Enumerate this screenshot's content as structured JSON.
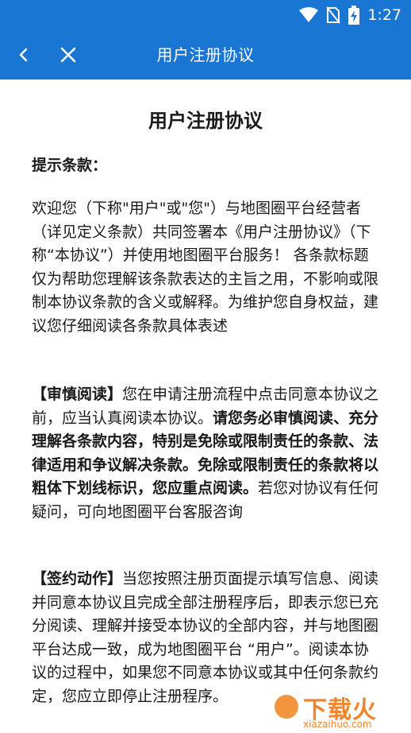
{
  "status_bar": {
    "time": "1:27"
  },
  "app_bar": {
    "title": "用户注册协议"
  },
  "document": {
    "title": "用户注册协议",
    "tips_heading": "提示条款：",
    "paragraph1": "欢迎您（下称\"用户\"或\"您\"）与地图圈平台经营者（详见定义条款）共同签署本《用户注册协议》（下称“本协议”）并使用地图圈平台服务！ 各条款标题仅为帮助您理解该条款表达的主旨之用，不影响或限制本协议条款的含义或解释。为维护您自身权益，建议您仔细阅读各条款具体表述",
    "paragraph2": {
      "label": "【审慎阅读】",
      "text1": "您在申请注册流程中点击同意本协议之前，应当认真阅读本协议。",
      "bold": "请您务必审慎阅读、充分理解各条款内容，特别是免除或限制责任的条款、法律适用和争议解决条款。免除或限制责任的条款将以粗体下划线标识，您应重点阅读。",
      "text2": "若您对协议有任何疑问，可向地图圈平台客服咨询"
    },
    "paragraph3": {
      "label": "【签约动作】",
      "text": "当您按照注册页面提示填写信息、阅读并同意本协议且完成全部注册程序后，即表示您已充分阅读、理解并接受本协议的全部内容，并与地图圈平台达成一致，成为地图圈平台 “用户”。阅读本协议的过程中，如果您不同意本协议或其中任何条款约定，您应立即停止注册程序。"
    }
  },
  "watermark": {
    "text": "下载火",
    "url": "xiazaihuo.com"
  },
  "colors": {
    "primary": "#1976d2",
    "text": "#1a1a1a",
    "watermark": "#f07b1a"
  }
}
